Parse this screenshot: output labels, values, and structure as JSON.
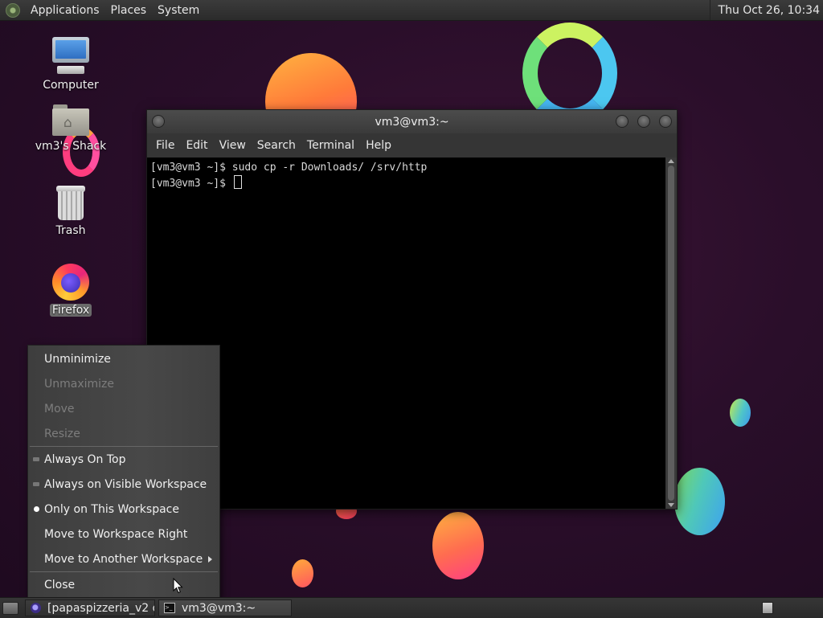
{
  "top_panel": {
    "menus": [
      "Applications",
      "Places",
      "System"
    ],
    "clock": "Thu Oct 26, 10:34"
  },
  "desktop_icons": [
    {
      "label": "Computer",
      "icon": "computer-icon"
    },
    {
      "label": "vm3's Shack",
      "icon": "home-folder-icon"
    },
    {
      "label": "Trash",
      "icon": "trash-icon"
    },
    {
      "label": "Firefox",
      "icon": "firefox-icon",
      "selected": true
    }
  ],
  "terminal": {
    "title": "vm3@vm3:~",
    "menus": [
      "File",
      "Edit",
      "View",
      "Search",
      "Terminal",
      "Help"
    ],
    "lines": [
      "[vm3@vm3 ~]$ sudo cp -r Downloads/ /srv/http",
      "[vm3@vm3 ~]$ "
    ]
  },
  "context_menu": {
    "items": [
      {
        "label": "Unminimize",
        "enabled": true
      },
      {
        "label": "Unmaximize",
        "enabled": false
      },
      {
        "label": "Move",
        "enabled": false
      },
      {
        "label": "Resize",
        "enabled": false
      },
      {
        "label": "Always On Top",
        "enabled": true,
        "marker": "check-off"
      },
      {
        "label": "Always on Visible Workspace",
        "enabled": true,
        "marker": "check-off"
      },
      {
        "label": "Only on This Workspace",
        "enabled": true,
        "marker": "radio-on"
      },
      {
        "label": "Move to Workspace Right",
        "enabled": true
      },
      {
        "label": "Move to Another Workspace",
        "enabled": true,
        "submenu": true
      },
      {
        "label": "Close",
        "enabled": true
      }
    ]
  },
  "taskbar": {
    "tasks": [
      {
        "label": "[papaspizzeria_v2 di...",
        "icon": "eclipse-icon",
        "active": false
      },
      {
        "label": "vm3@vm3:~",
        "icon": "terminal-icon",
        "active": true
      }
    ]
  },
  "colors": {
    "desktop_bg": "#2a0e2a",
    "panel_bg": "#333333",
    "menu_bg": "#444444",
    "terminal_bg": "#000000"
  }
}
